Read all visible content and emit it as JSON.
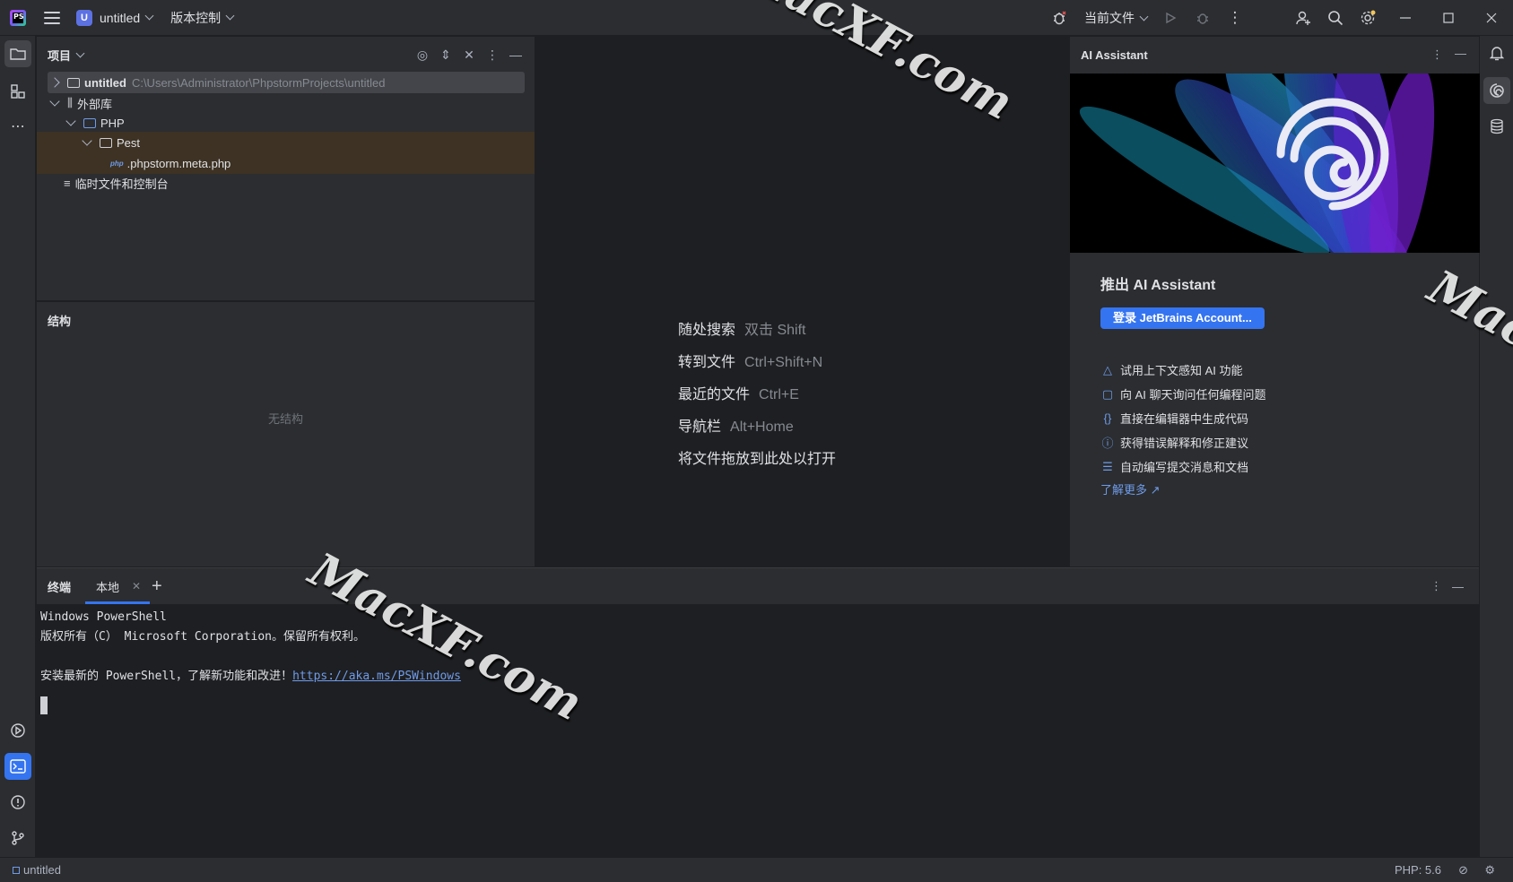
{
  "titlebar": {
    "logo": "PS",
    "project_badge": "U",
    "project_name": "untitled",
    "vcs": "版本控制",
    "run_config": "当前文件"
  },
  "project_panel": {
    "title": "项目",
    "tree": [
      {
        "label": "untitled",
        "path": "C:\\Users\\Administrator\\PhpstormProjects\\untitled"
      },
      {
        "label": "外部库"
      },
      {
        "label": "PHP"
      },
      {
        "label": "Pest"
      },
      {
        "label": ".phpstorm.meta.php",
        "icon_text": "php"
      },
      {
        "label": "临时文件和控制台"
      }
    ]
  },
  "structure_panel": {
    "title": "结构",
    "empty": "无结构"
  },
  "editor": {
    "hints": [
      {
        "label": "随处搜索",
        "key": "双击 Shift"
      },
      {
        "label": "转到文件",
        "key": "Ctrl+Shift+N"
      },
      {
        "label": "最近的文件",
        "key": "Ctrl+E"
      },
      {
        "label": "导航栏",
        "key": "Alt+Home"
      },
      {
        "label": "将文件拖放到此处以打开",
        "key": ""
      }
    ]
  },
  "ai_panel": {
    "title": "AI Assistant",
    "heading": "推出 AI Assistant",
    "login_button": "登录 JetBrains Account...",
    "features": [
      {
        "icon": "context-icon",
        "label": "试用上下文感知 AI 功能"
      },
      {
        "icon": "chat-icon",
        "label": "向 AI 聊天询问任何编程问题"
      },
      {
        "icon": "braces-icon",
        "label": "直接在编辑器中生成代码"
      },
      {
        "icon": "question-icon",
        "label": "获得错误解释和修正建议"
      },
      {
        "icon": "commit-icon",
        "label": "自动编写提交消息和文档"
      }
    ],
    "learn_more": "了解更多 ↗"
  },
  "terminal": {
    "title": "终端",
    "tab": "本地",
    "lines": [
      "Windows PowerShell",
      "版权所有（C） Microsoft Corporation。保留所有权利。",
      "",
      "安装最新的 PowerShell，了解新功能和改进！"
    ],
    "link": "https://aka.ms/PSWindows"
  },
  "statusbar": {
    "project": "untitled",
    "php_version": "PHP: 5.6"
  },
  "watermarks": [
    "MacXF.com",
    "MacXF.com",
    "Mac"
  ],
  "colors": {
    "accent": "#3574f0",
    "panel": "#2b2d30",
    "editor": "#1e1f22",
    "link": "#6f9be8"
  }
}
